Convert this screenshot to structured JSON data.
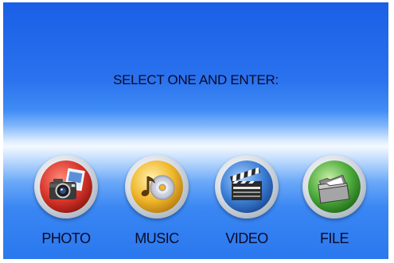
{
  "prompt": "SELECT ONE AND ENTER:",
  "menu": {
    "items": [
      {
        "label": "PHOTO",
        "icon": "camera-icon",
        "color": "#d9362b"
      },
      {
        "label": "MUSIC",
        "icon": "music-cd-icon",
        "color": "#f0b62a"
      },
      {
        "label": "VIDEO",
        "icon": "clapperboard-icon",
        "color": "#3c7fd6"
      },
      {
        "label": "FILE",
        "icon": "folder-icon",
        "color": "#4caa3a"
      }
    ]
  }
}
